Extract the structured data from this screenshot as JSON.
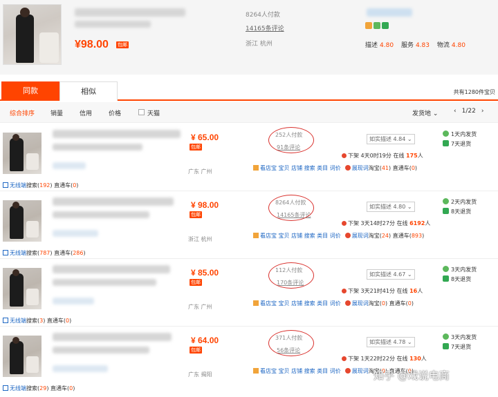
{
  "header_product": {
    "price": "¥98.00",
    "badge": "包邮",
    "paid_count": "8264人付款",
    "review_count": "14165条评论",
    "location": "浙江 杭州",
    "ratings": [
      {
        "label": "描述",
        "value": "4.80"
      },
      {
        "label": "服务",
        "value": "4.83"
      },
      {
        "label": "物流",
        "value": "4.80"
      }
    ]
  },
  "tabs": [
    {
      "label": "同款",
      "active": true
    },
    {
      "label": "相似",
      "active": false
    }
  ],
  "total_text": "共有1280件宝贝",
  "sort": {
    "items": [
      "综合排序",
      "销量",
      "信用",
      "价格",
      "天猫"
    ],
    "ship_from": "发货地",
    "page": "1/22"
  },
  "rows": [
    {
      "price": "¥ 65.00",
      "badge": "包邮",
      "location": "广东 广州",
      "paid": "252人付款",
      "reviews": "91条评论",
      "match": "如实描述 4.84",
      "shelf_prefix": "下架 4天0时19分 在线 ",
      "online": "175",
      "shelf_suffix": "人",
      "tools": "看店宝 宝贝 店铺 搜索 类目 词价",
      "zhanxian": "展现词",
      "taobao_label": "淘宝(",
      "taobao": "41",
      "zhitongche_label": ") 直通车(",
      "zhitongche": "0",
      "close": ")",
      "wx_label": "无线端",
      "wx_search_label": "搜索(",
      "wx_search": "192",
      "wx_ztc_label": ") 直通车(",
      "wx_ztc": "0",
      "wx_close": ")",
      "promise1": "1天内发货",
      "promise2": "7天退货"
    },
    {
      "price": "¥ 98.00",
      "badge": "包邮",
      "location": "浙江 杭州",
      "paid": "8264人付款",
      "reviews": "14165条评论",
      "match": "如实描述 4.80",
      "shelf_prefix": "下架 3天14时27分 在线 ",
      "online": "6192",
      "shelf_suffix": "人",
      "tools": "看店宝 宝贝 店铺 搜索 类目 词价",
      "zhanxian": "展现词",
      "taobao_label": "淘宝(",
      "taobao": "24",
      "zhitongche_label": ") 直通车(",
      "zhitongche": "893",
      "close": ")",
      "wx_label": "无线端",
      "wx_search_label": "搜索(",
      "wx_search": "787",
      "wx_ztc_label": ") 直通车(",
      "wx_ztc": "286",
      "wx_close": ")",
      "promise1": "2天内发货",
      "promise2": "8天退货"
    },
    {
      "price": "¥ 85.00",
      "badge": "包邮",
      "location": "广东 广州",
      "paid": "112人付款",
      "reviews": "170条评论",
      "match": "如实描述 4.67",
      "shelf_prefix": "下架 3天21时41分 在线 ",
      "online": "16",
      "shelf_suffix": "人",
      "tools": "看店宝 宝贝 店铺 搜索 类目 词价",
      "zhanxian": "展现词",
      "taobao_label": "淘宝(",
      "taobao": "0",
      "zhitongche_label": ") 直通车(",
      "zhitongche": "0",
      "close": ")",
      "wx_label": "无线端",
      "wx_search_label": "搜索(",
      "wx_search": "3",
      "wx_ztc_label": ") 直通车(",
      "wx_ztc": "0",
      "wx_close": ")",
      "promise1": "3天内发货",
      "promise2": "8天退货"
    },
    {
      "price": "¥ 64.00",
      "badge": "包邮",
      "location": "广东 揭阳",
      "paid": "371人付款",
      "reviews": "56条评论",
      "match": "如实描述 4.78",
      "shelf_prefix": "下架 1天22时22分 在线 ",
      "online": "130",
      "shelf_suffix": "人",
      "tools": "看店宝 宝贝 店铺 搜索 类目 词价",
      "zhanxian": "展现词",
      "taobao_label": "淘宝(",
      "taobao": "0",
      "zhitongche_label": ") 直通车(",
      "zhitongche": "0",
      "close": ")",
      "wx_label": "无线端",
      "wx_search_label": "搜索(",
      "wx_search": "29",
      "wx_ztc_label": ") 直通车(",
      "wx_ztc": "0",
      "wx_close": ")",
      "promise1": "3天内发货",
      "promise2": "7天退货"
    }
  ],
  "watermark": "知乎 @戏说电商",
  "colors": {
    "accent": "#ff4400",
    "link": "#1c66c3",
    "circle": "#d9302c"
  }
}
